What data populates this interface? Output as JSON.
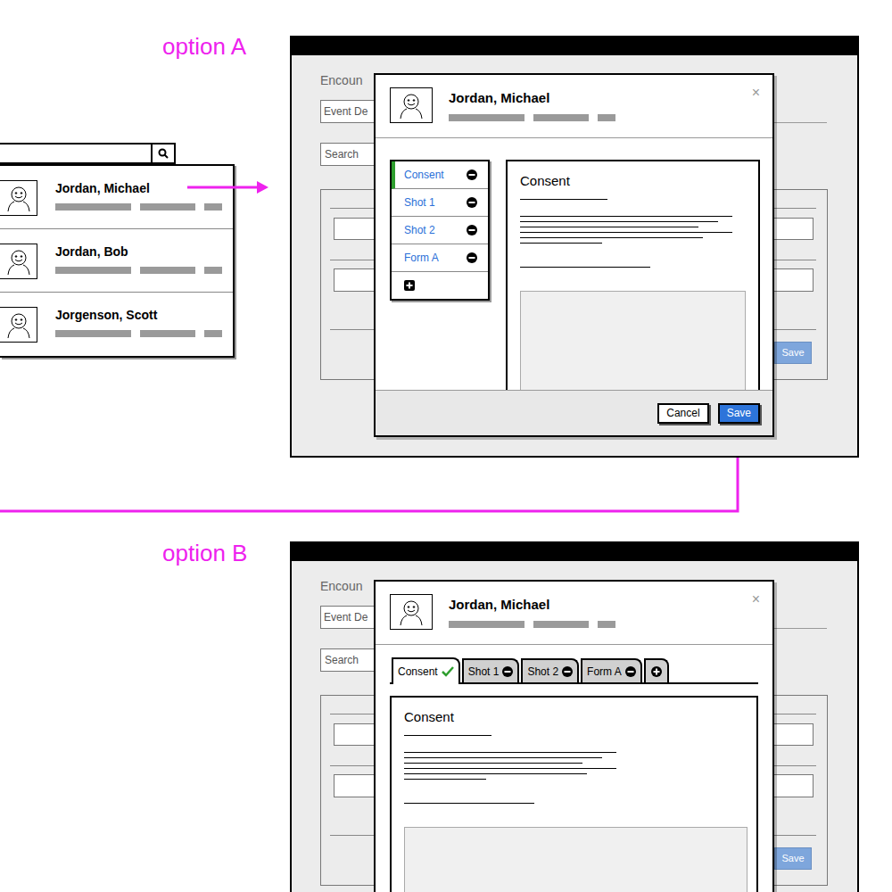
{
  "search_list": {
    "items": [
      {
        "name": "Jordan, Michael"
      },
      {
        "name": "Jordan, Bob"
      },
      {
        "name": "Jorgenson, Scott"
      }
    ]
  },
  "options": [
    {
      "label": "option A",
      "kind": "sidebar",
      "background": {
        "title": "Encoun",
        "event_field": "Event De",
        "search_field": "Search",
        "save_button": "Save"
      },
      "patient": {
        "name": "Jordan, Michael",
        "close": "×"
      },
      "sections": [
        {
          "label": "Consent",
          "selected": true,
          "complete": false
        },
        {
          "label": "Shot 1",
          "selected": false,
          "complete": false
        },
        {
          "label": "Shot 2",
          "selected": false,
          "complete": false
        },
        {
          "label": "Form A",
          "selected": false,
          "complete": false
        }
      ],
      "content_title": "Consent",
      "buttons": [
        "Cancel",
        "Save"
      ]
    },
    {
      "label": "option B",
      "kind": "tabs",
      "background": {
        "title": "Encoun",
        "event_field": "Event De",
        "search_field": "Search",
        "save_button": "Save"
      },
      "patient": {
        "name": "Jordan, Michael",
        "close": "×"
      },
      "sections": [
        {
          "label": "Consent",
          "selected": true,
          "complete": true
        },
        {
          "label": "Shot 1",
          "selected": false,
          "complete": false
        },
        {
          "label": "Shot 2",
          "selected": false,
          "complete": false
        },
        {
          "label": "Form A",
          "selected": false,
          "complete": false
        }
      ],
      "content_title": "Consent",
      "buttons": []
    }
  ]
}
